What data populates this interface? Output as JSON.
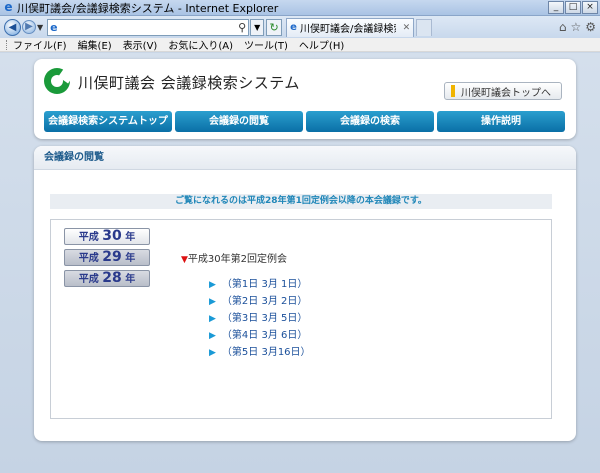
{
  "window": {
    "title": "川俣町議会/会議録検索システム - Internet Explorer",
    "minimize": "_",
    "maximize": "□",
    "close": "×"
  },
  "browser": {
    "tab_title": "川俣町議会/会議録検索シ...",
    "address_value": ""
  },
  "menu": {
    "items": [
      "ファイル(F)",
      "編集(E)",
      "表示(V)",
      "お気に入り(A)",
      "ツール(T)",
      "ヘルプ(H)"
    ]
  },
  "header": {
    "site_title": "川俣町議会 会議録検索システム",
    "top_link": "川俣町議会トップへ",
    "nav": [
      "会議録検索システムトップ",
      "会議録の閲覧",
      "会議録の検索",
      "操作説明"
    ]
  },
  "content": {
    "heading": "会議録の閲覧",
    "notice": "ご覧になれるのは平成28年第1回定例会以降の本会議録です。",
    "years": [
      {
        "prefix": "平成",
        "num": "30",
        "suffix": "年"
      },
      {
        "prefix": "平成",
        "num": "29",
        "suffix": "年"
      },
      {
        "prefix": "平成",
        "num": "28",
        "suffix": "年"
      }
    ],
    "session": "平成30年第2回定例会",
    "days": [
      "（第1日 3月 1日）",
      "（第2日 3月 2日）",
      "（第3日 3月 5日）",
      "（第4日 3月 6日）",
      "（第5日 3月16日）"
    ]
  }
}
